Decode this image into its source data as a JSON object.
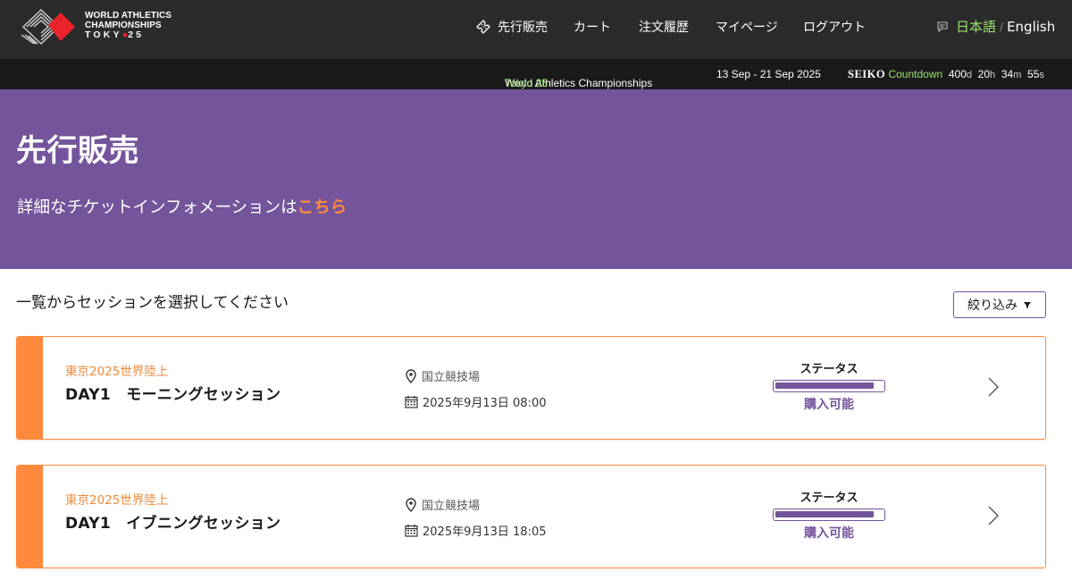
{
  "header": {
    "logo_lines": [
      "WORLD ATHLETICS",
      "CHAMPIONSHIPS",
      "TOKY",
      "25"
    ],
    "nav": [
      {
        "label": "先行販売",
        "icon": "ticket-icon"
      },
      {
        "label": "カート"
      },
      {
        "label": "注文履歴"
      },
      {
        "label": "マイページ"
      },
      {
        "label": "ログアウト"
      }
    ],
    "lang_current": "日本語",
    "lang_sep": "/",
    "lang_other": "English"
  },
  "subbar": {
    "event_name": "World Athletics Championships",
    "event_city": "Tokyo 25",
    "dates": "13 Sep - 21 Sep 2025",
    "sponsor": "SEIKO",
    "countdown_label": "Countdown",
    "countdown": {
      "d": "400",
      "h": "20",
      "m": "34",
      "s": "55"
    }
  },
  "hero": {
    "title": "先行販売",
    "info_text": "詳細なチケットインフォメーションは",
    "info_link": "こちら"
  },
  "main": {
    "select_title": "一覧からセッションを選択してください",
    "filter_label": "絞り込み"
  },
  "sessions": [
    {
      "event": "東京2025世界陸上",
      "session": "DAY1　モーニングセッション",
      "venue": "国立競技場",
      "datetime": "2025年9月13日 08:00",
      "status_label": "ステータス",
      "status_text": "購入可能",
      "status_level": 0.92
    },
    {
      "event": "東京2025世界陸上",
      "session": "DAY1　イブニングセッション",
      "venue": "国立競技場",
      "datetime": "2025年9月13日 18:05",
      "status_label": "ステータス",
      "status_text": "購入可能",
      "status_level": 0.92
    }
  ],
  "colors": {
    "purple": "#74549b",
    "orange": "#ff8a3d",
    "green": "#9be36a",
    "dark": "#2b2b2b"
  }
}
